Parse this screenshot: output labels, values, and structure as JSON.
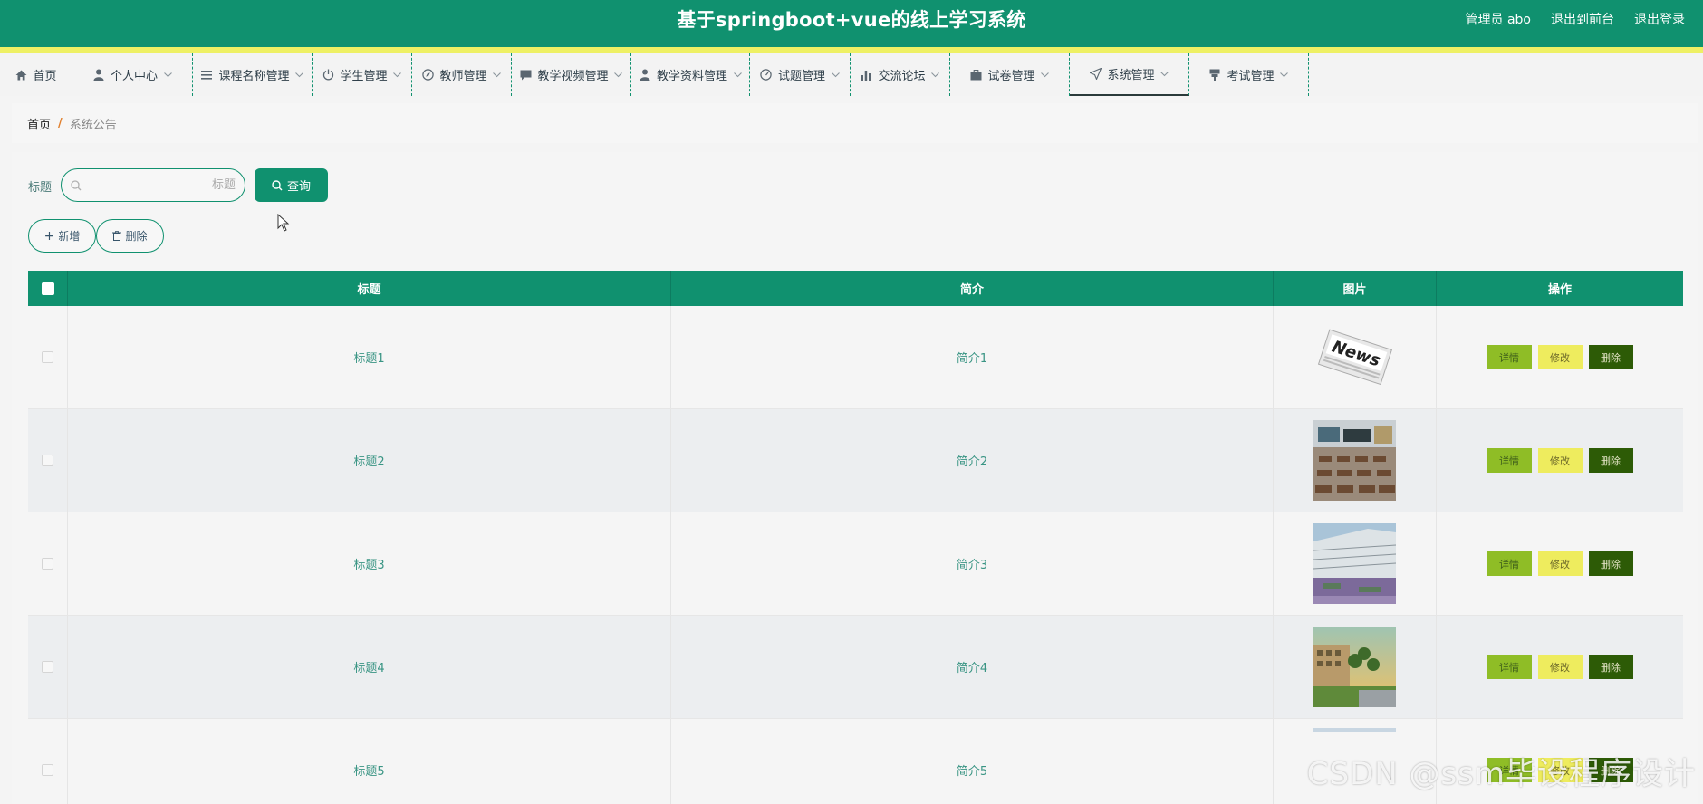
{
  "header": {
    "title": "基于springboot+vue的线上学习系统",
    "user": "管理员 abo",
    "back_to_front": "退出到前台",
    "logout": "退出登录"
  },
  "nav": {
    "items": [
      {
        "label": "首页",
        "icon": "home-icon"
      },
      {
        "label": "个人中心",
        "icon": "user-icon"
      },
      {
        "label": "课程名称管理",
        "icon": "list-icon"
      },
      {
        "label": "学生管理",
        "icon": "power-icon"
      },
      {
        "label": "教师管理",
        "icon": "compass-icon"
      },
      {
        "label": "教学视频管理",
        "icon": "comment-icon"
      },
      {
        "label": "教学资料管理",
        "icon": "user-icon"
      },
      {
        "label": "试题管理",
        "icon": "dashboard-icon"
      },
      {
        "label": "交流论坛",
        "icon": "chart-icon"
      },
      {
        "label": "试卷管理",
        "icon": "briefcase-icon"
      },
      {
        "label": "系统管理",
        "icon": "send-icon",
        "active": true
      },
      {
        "label": "考试管理",
        "icon": "cup-icon"
      }
    ]
  },
  "breadcrumb": {
    "home": "首页",
    "separator": "/",
    "current": "系统公告"
  },
  "search": {
    "label": "标题",
    "placeholder": "标题",
    "query_button": "查询"
  },
  "actions": {
    "add": "新增",
    "delete": "删除"
  },
  "table": {
    "columns": [
      "标题",
      "简介",
      "图片",
      "操作"
    ],
    "rows": [
      {
        "title": "标题1",
        "intro": "简介1",
        "image": "news"
      },
      {
        "title": "标题2",
        "intro": "简介2",
        "image": "classroom"
      },
      {
        "title": "标题3",
        "intro": "简介3",
        "image": "courtyard"
      },
      {
        "title": "标题4",
        "intro": "简介4",
        "image": "campus"
      },
      {
        "title": "标题5",
        "intro": "简介5",
        "image": "sky"
      }
    ],
    "op_labels": {
      "detail": "详情",
      "edit": "修改",
      "remove": "删除"
    }
  },
  "watermark": "CSDN @ssm毕设程序设计",
  "colors": {
    "primary": "#10916f",
    "strip": "#eef064",
    "detail": "#8fbd26",
    "edit": "#eeec5e",
    "remove": "#2d5b06"
  }
}
